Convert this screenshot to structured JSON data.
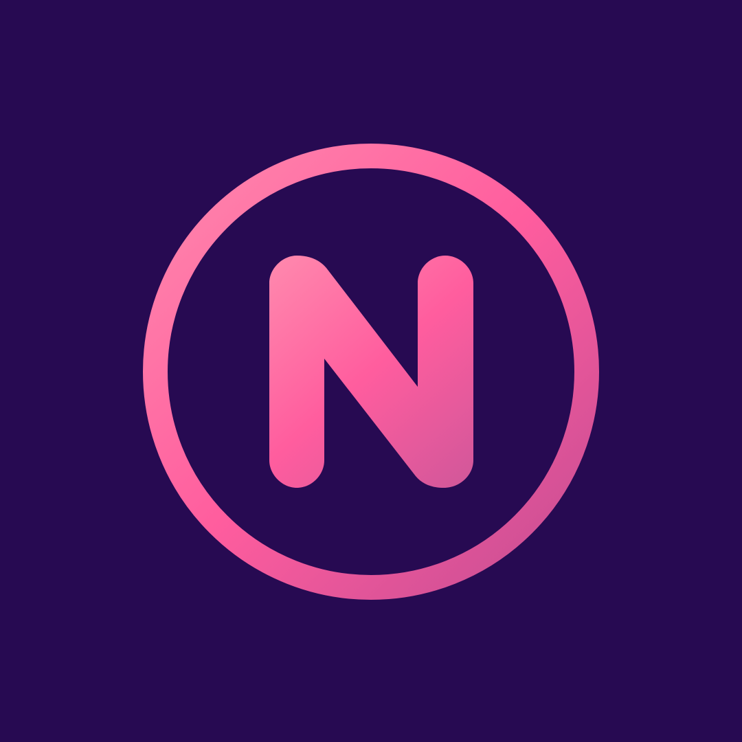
{
  "logo": {
    "letter": "N",
    "icon": "n-circle-logo-icon"
  },
  "colors": {
    "background": "#270A52",
    "gradient_start": "#FF8AAE",
    "gradient_mid": "#FF5D9E",
    "gradient_end": "#C24C93"
  }
}
